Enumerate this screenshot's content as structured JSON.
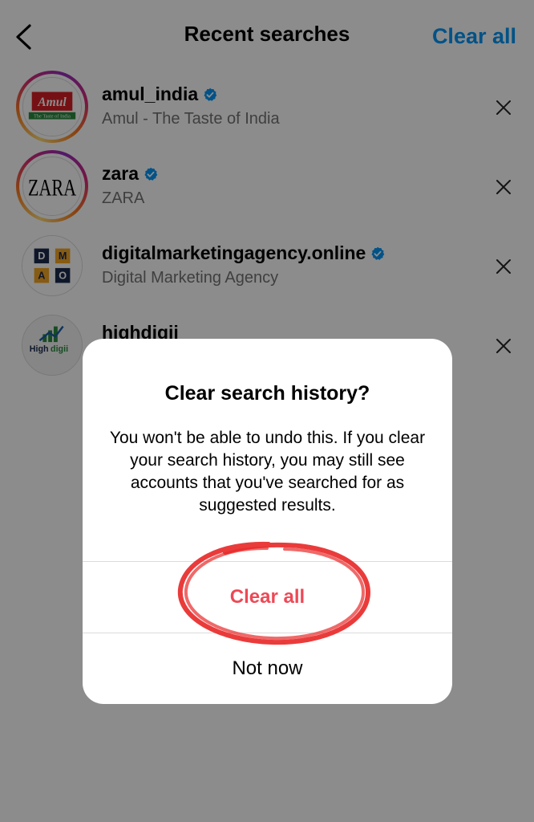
{
  "header": {
    "title": "Recent searches",
    "clear_all_label": "Clear all"
  },
  "recent_searches": [
    {
      "username": "amul_india",
      "subtitle": "Amul - The Taste of India",
      "verified": true,
      "story_ring": true,
      "avatar_text": "Amul",
      "avatar_tagline": "The Taste of India"
    },
    {
      "username": "zara",
      "subtitle": "ZARA",
      "verified": true,
      "story_ring": true,
      "avatar_text": "ZARA"
    },
    {
      "username": "digitalmarketingagency.online",
      "subtitle": "Digital Marketing Agency",
      "verified": true,
      "story_ring": false,
      "avatar_letters": [
        "D",
        "M",
        "A",
        "O"
      ]
    },
    {
      "username": "highdigii",
      "subtitle": "",
      "verified": false,
      "story_ring": false,
      "avatar_text_a": "High",
      "avatar_text_b": "digii"
    }
  ],
  "dialog": {
    "title": "Clear search history?",
    "body": "You won't be able to undo this. If you clear your search history, you may still see accounts that you've searched for as suggested results.",
    "clear_all_label": "Clear all",
    "not_now_label": "Not now"
  },
  "colors": {
    "link_blue": "#0095f6",
    "destructive_red": "#ed4956",
    "verified_blue": "#0095f6",
    "annotation_red": "#e82a2a"
  }
}
